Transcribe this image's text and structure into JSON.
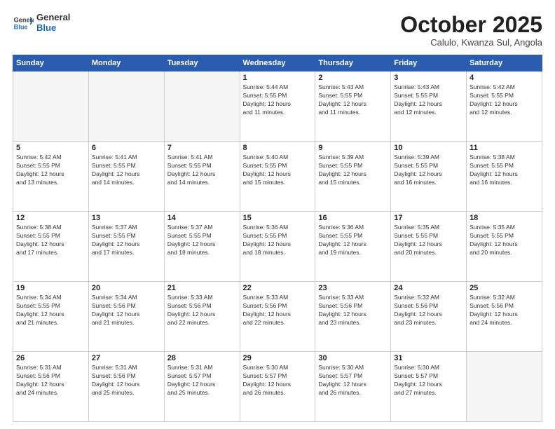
{
  "header": {
    "logo_line1": "General",
    "logo_line2": "Blue",
    "month": "October 2025",
    "location": "Calulo, Kwanza Sul, Angola"
  },
  "days_of_week": [
    "Sunday",
    "Monday",
    "Tuesday",
    "Wednesday",
    "Thursday",
    "Friday",
    "Saturday"
  ],
  "weeks": [
    [
      {
        "day": "",
        "info": ""
      },
      {
        "day": "",
        "info": ""
      },
      {
        "day": "",
        "info": ""
      },
      {
        "day": "1",
        "info": "Sunrise: 5:44 AM\nSunset: 5:55 PM\nDaylight: 12 hours\nand 11 minutes."
      },
      {
        "day": "2",
        "info": "Sunrise: 5:43 AM\nSunset: 5:55 PM\nDaylight: 12 hours\nand 11 minutes."
      },
      {
        "day": "3",
        "info": "Sunrise: 5:43 AM\nSunset: 5:55 PM\nDaylight: 12 hours\nand 12 minutes."
      },
      {
        "day": "4",
        "info": "Sunrise: 5:42 AM\nSunset: 5:55 PM\nDaylight: 12 hours\nand 12 minutes."
      }
    ],
    [
      {
        "day": "5",
        "info": "Sunrise: 5:42 AM\nSunset: 5:55 PM\nDaylight: 12 hours\nand 13 minutes."
      },
      {
        "day": "6",
        "info": "Sunrise: 5:41 AM\nSunset: 5:55 PM\nDaylight: 12 hours\nand 14 minutes."
      },
      {
        "day": "7",
        "info": "Sunrise: 5:41 AM\nSunset: 5:55 PM\nDaylight: 12 hours\nand 14 minutes."
      },
      {
        "day": "8",
        "info": "Sunrise: 5:40 AM\nSunset: 5:55 PM\nDaylight: 12 hours\nand 15 minutes."
      },
      {
        "day": "9",
        "info": "Sunrise: 5:39 AM\nSunset: 5:55 PM\nDaylight: 12 hours\nand 15 minutes."
      },
      {
        "day": "10",
        "info": "Sunrise: 5:39 AM\nSunset: 5:55 PM\nDaylight: 12 hours\nand 16 minutes."
      },
      {
        "day": "11",
        "info": "Sunrise: 5:38 AM\nSunset: 5:55 PM\nDaylight: 12 hours\nand 16 minutes."
      }
    ],
    [
      {
        "day": "12",
        "info": "Sunrise: 5:38 AM\nSunset: 5:55 PM\nDaylight: 12 hours\nand 17 minutes."
      },
      {
        "day": "13",
        "info": "Sunrise: 5:37 AM\nSunset: 5:55 PM\nDaylight: 12 hours\nand 17 minutes."
      },
      {
        "day": "14",
        "info": "Sunrise: 5:37 AM\nSunset: 5:55 PM\nDaylight: 12 hours\nand 18 minutes."
      },
      {
        "day": "15",
        "info": "Sunrise: 5:36 AM\nSunset: 5:55 PM\nDaylight: 12 hours\nand 18 minutes."
      },
      {
        "day": "16",
        "info": "Sunrise: 5:36 AM\nSunset: 5:55 PM\nDaylight: 12 hours\nand 19 minutes."
      },
      {
        "day": "17",
        "info": "Sunrise: 5:35 AM\nSunset: 5:55 PM\nDaylight: 12 hours\nand 20 minutes."
      },
      {
        "day": "18",
        "info": "Sunrise: 5:35 AM\nSunset: 5:55 PM\nDaylight: 12 hours\nand 20 minutes."
      }
    ],
    [
      {
        "day": "19",
        "info": "Sunrise: 5:34 AM\nSunset: 5:55 PM\nDaylight: 12 hours\nand 21 minutes."
      },
      {
        "day": "20",
        "info": "Sunrise: 5:34 AM\nSunset: 5:56 PM\nDaylight: 12 hours\nand 21 minutes."
      },
      {
        "day": "21",
        "info": "Sunrise: 5:33 AM\nSunset: 5:56 PM\nDaylight: 12 hours\nand 22 minutes."
      },
      {
        "day": "22",
        "info": "Sunrise: 5:33 AM\nSunset: 5:56 PM\nDaylight: 12 hours\nand 22 minutes."
      },
      {
        "day": "23",
        "info": "Sunrise: 5:33 AM\nSunset: 5:56 PM\nDaylight: 12 hours\nand 23 minutes."
      },
      {
        "day": "24",
        "info": "Sunrise: 5:32 AM\nSunset: 5:56 PM\nDaylight: 12 hours\nand 23 minutes."
      },
      {
        "day": "25",
        "info": "Sunrise: 5:32 AM\nSunset: 5:56 PM\nDaylight: 12 hours\nand 24 minutes."
      }
    ],
    [
      {
        "day": "26",
        "info": "Sunrise: 5:31 AM\nSunset: 5:56 PM\nDaylight: 12 hours\nand 24 minutes."
      },
      {
        "day": "27",
        "info": "Sunrise: 5:31 AM\nSunset: 5:56 PM\nDaylight: 12 hours\nand 25 minutes."
      },
      {
        "day": "28",
        "info": "Sunrise: 5:31 AM\nSunset: 5:57 PM\nDaylight: 12 hours\nand 25 minutes."
      },
      {
        "day": "29",
        "info": "Sunrise: 5:30 AM\nSunset: 5:57 PM\nDaylight: 12 hours\nand 26 minutes."
      },
      {
        "day": "30",
        "info": "Sunrise: 5:30 AM\nSunset: 5:57 PM\nDaylight: 12 hours\nand 26 minutes."
      },
      {
        "day": "31",
        "info": "Sunrise: 5:30 AM\nSunset: 5:57 PM\nDaylight: 12 hours\nand 27 minutes."
      },
      {
        "day": "",
        "info": ""
      }
    ]
  ]
}
